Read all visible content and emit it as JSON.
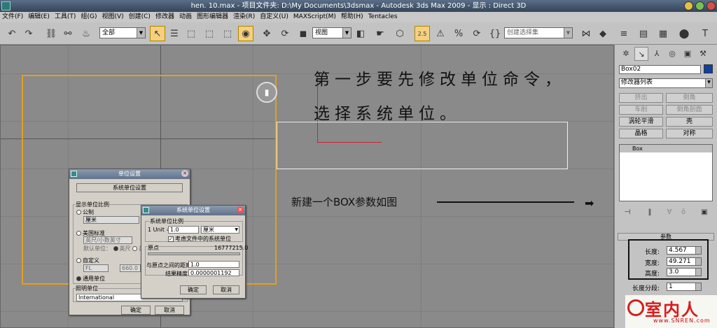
{
  "window": {
    "title": "hen. 10.max    - 项目文件夹: D:\\My Documents\\3dsmax    - Autodesk 3ds Max  2009    - 显示 : Direct 3D"
  },
  "menu": [
    "文件(F)",
    "编辑(E)",
    "工具(T)",
    "组(G)",
    "视图(V)",
    "创建(C)",
    "修改器",
    "动画",
    "图形编辑器",
    "渲染(R)",
    "自定义(U)",
    "MAXScript(M)",
    "帮助(H)",
    "Tentacles"
  ],
  "toolbar": {
    "selection_filter": "全部",
    "coord_system": "视图",
    "named_selection": "创建选择集",
    "snap_value": "2.5"
  },
  "annotations": {
    "heading_line1": "第一步要先修改单位命令，",
    "heading_line2": "选择系统单位。",
    "note": "新建一个BOX参数如图"
  },
  "units_dialog": {
    "title": "单位设置",
    "system_units_button": "系统单位设置",
    "display_scale_label": "显示单位比例",
    "metric": "公制",
    "metric_value": "厘米",
    "us_standard": "美国标准",
    "us_value": "英尺/小数英寸",
    "default_units": "默认单位：",
    "feet": "英尺",
    "inches": "英寸",
    "custom": "自定义",
    "custom_value": "FL",
    "custom_num": "660.0",
    "generic": "通用单位",
    "lighting_label": "照明单位",
    "lighting_value": "International",
    "ok": "确定",
    "cancel": "取消"
  },
  "system_dialog": {
    "title": "系统单位设置",
    "scale_group": "系统单位比例",
    "unit_prefix": "1 Unit =",
    "unit_value": "1.0",
    "unit_type": "厘米",
    "respect_files": "考虑文件中的系统单位",
    "origin_label": "原点",
    "origin_value": "16777215.0",
    "distance_label": "与原点之间的距离：",
    "distance_value": "1.0",
    "precision_label": "结果精度：",
    "precision_value": "0.0000001192",
    "ok": "确定",
    "cancel": "取消"
  },
  "command_panel": {
    "object_name": "Box02",
    "modifier_list": "修改器列表",
    "buttons": [
      "挤出",
      "倒角",
      "车削",
      "倒角剖面",
      "涡轮平滑",
      "壳",
      "晶格",
      "对称"
    ],
    "stack_item": "Box",
    "rollout_title": "参数",
    "length_label": "长度:",
    "length_value": "4.567",
    "width_label": "宽度:",
    "width_value": "49.271",
    "height_label": "高度:",
    "height_value": "3.0",
    "length_segs_label": "长度分段:",
    "length_segs_value": "1"
  },
  "logo": {
    "name": "室内人",
    "url": "www.SNREN.com"
  },
  "colors": {
    "selection": "#e0a020",
    "axis": "#cc2233",
    "object_color": "#1040a0"
  }
}
